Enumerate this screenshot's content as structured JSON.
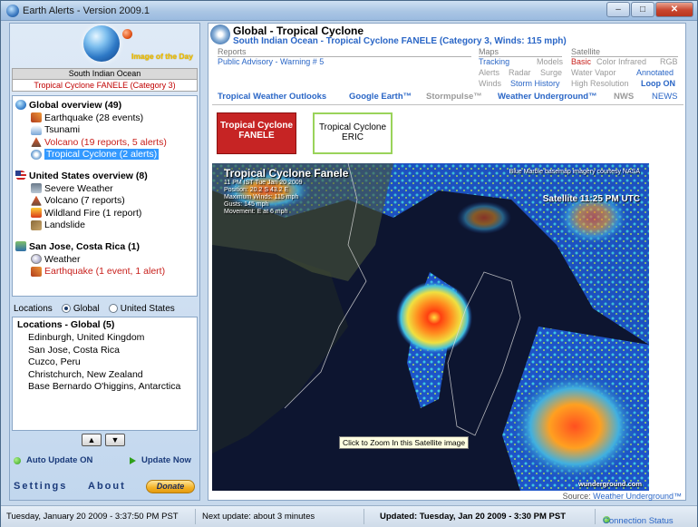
{
  "window": {
    "title": "Earth Alerts - Version 2009.1",
    "min": "–",
    "max": "□",
    "close": "✕"
  },
  "left": {
    "image_of_day": "Image of the Day",
    "region": "South Indian Ocean",
    "region_sub": "Tropical Cyclone FANELE (Category 3)",
    "groups": [
      {
        "title": "Global overview (49)",
        "items": [
          {
            "label": "Earthquake (28 events)"
          },
          {
            "label": "Tsunami"
          },
          {
            "label": "Volcano (19 reports, 5 alerts)"
          },
          {
            "label": "Tropical Cyclone (2 alerts)"
          }
        ]
      },
      {
        "title": "United States overview (8)",
        "items": [
          {
            "label": "Severe Weather"
          },
          {
            "label": "Volcano (7 reports)"
          },
          {
            "label": "Wildland Fire (1 report)"
          },
          {
            "label": "Landslide"
          }
        ]
      },
      {
        "title": "San Jose, Costa Rica (1)",
        "items": [
          {
            "label": "Weather"
          },
          {
            "label": "Earthquake (1 event, 1 alert)"
          }
        ]
      }
    ],
    "locations_label": "Locations",
    "opt_global": "Global",
    "opt_us": "United States",
    "loc_title": "Locations - Global (5)",
    "locations": [
      "Edinburgh, United Kingdom",
      "San Jose, Costa Rica",
      "Cuzco, Peru",
      "Christchurch, New Zealand",
      "Base Bernardo O'higgins, Antarctica"
    ],
    "up": "▲",
    "down": "▼",
    "auto_update": "Auto Update ON",
    "update_now": "Update Now",
    "settings": "Settings",
    "about": "About",
    "donate": "Donate"
  },
  "right": {
    "title": "Global - Tropical Cyclone",
    "subtitle": "South Indian Ocean - Tropical Cyclone FANELE (Category 3, Winds: 115 mph)",
    "reports_h": "Reports",
    "advisory": "Public Advisory - Warning # 5",
    "maps_h": "Maps",
    "maps": {
      "tracking": "Tracking",
      "models": "Models",
      "alerts": "Alerts",
      "radar": "Radar",
      "surge": "Surge",
      "winds": "Winds",
      "storm_history": "Storm History"
    },
    "sat_h": "Satellite",
    "sat": {
      "basic": "Basic",
      "color_ir": "Color Infrared",
      "rgb": "RGB",
      "water_vapor": "Water Vapor",
      "annotated": "Annotated",
      "high_res": "High Resolution",
      "loop": "Loop ON"
    },
    "nav": {
      "outlooks": "Tropical Weather Outlooks",
      "google": "Google Earth™",
      "stormpulse": "Stormpulse™",
      "wu": "Weather Underground™",
      "nws": "NWS",
      "news": "NEWS"
    },
    "btn_fanele": "Tropical Cyclone FANELE",
    "btn_eric": "Tropical Cyclone ERIC",
    "sat_title": "Tropical Cyclone Fanele",
    "sat_info": [
      "11 PM IST Tue Jan 20 2009",
      "Position: 20.2 S 43.2 E",
      "Maximum Winds: 115 mph",
      "Gusts: 145 mph",
      "Movement: E at 6 mph"
    ],
    "sat_credit": "Blue Marble basemap imagery courtesy NASA",
    "sat_time": "Satellite 11:25 PM UTC",
    "sat_tooltip": "Click to Zoom In this Satellite image",
    "sat_wu": "wunderground.com",
    "source_label": "Source:",
    "source_link": "Weather Underground™"
  },
  "status": {
    "datetime": "Tuesday, January 20 2009 - 3:37:50 PM PST",
    "next": "Next update: about 3 minutes",
    "updated": "Updated: Tuesday, Jan 20 2009 - 3:30 PM PST",
    "connection": "Connection Status"
  }
}
